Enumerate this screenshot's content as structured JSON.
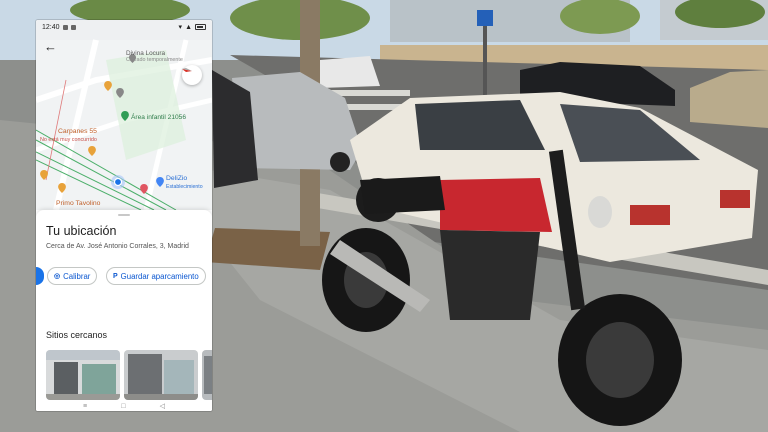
{
  "status_bar": {
    "time": "12:40",
    "battery_icon": "battery-icon",
    "signal_icon": "signal-icon",
    "wifi_icon": "wifi-icon"
  },
  "map": {
    "back_icon": "back-arrow-icon",
    "compass_icon": "compass-icon",
    "places": [
      {
        "key": "divina",
        "name": "Divina Locura",
        "subtitle": "Cerrado temporalmente"
      },
      {
        "key": "area",
        "name": "Área infantil 21056"
      },
      {
        "key": "carpanes",
        "name": "Carpanes 55",
        "subtitle": "No está muy concurrido"
      },
      {
        "key": "delizio",
        "name": "DeliZio",
        "subtitle": "Establecimiento"
      },
      {
        "key": "primo",
        "name": "Primo Tavolino"
      }
    ]
  },
  "sheet": {
    "title": "Tu ubicación",
    "address": "Cerca de Av. José Antonio Corrales, 3, Madrid",
    "actions": [
      {
        "label": "Calibrar",
        "icon": "calibrate-icon"
      },
      {
        "label": "Guardar aparcamiento",
        "icon": "parking-icon"
      }
    ],
    "nearby_title": "Sitios cercanos"
  },
  "navbar": {
    "items": [
      "menu-icon",
      "home-icon",
      "back-icon"
    ]
  },
  "colors": {
    "accent": "#1a73e8",
    "chip_text": "#0b57d0",
    "restaurant_pin": "#e8a23a",
    "park_green": "#2f7d4b"
  }
}
